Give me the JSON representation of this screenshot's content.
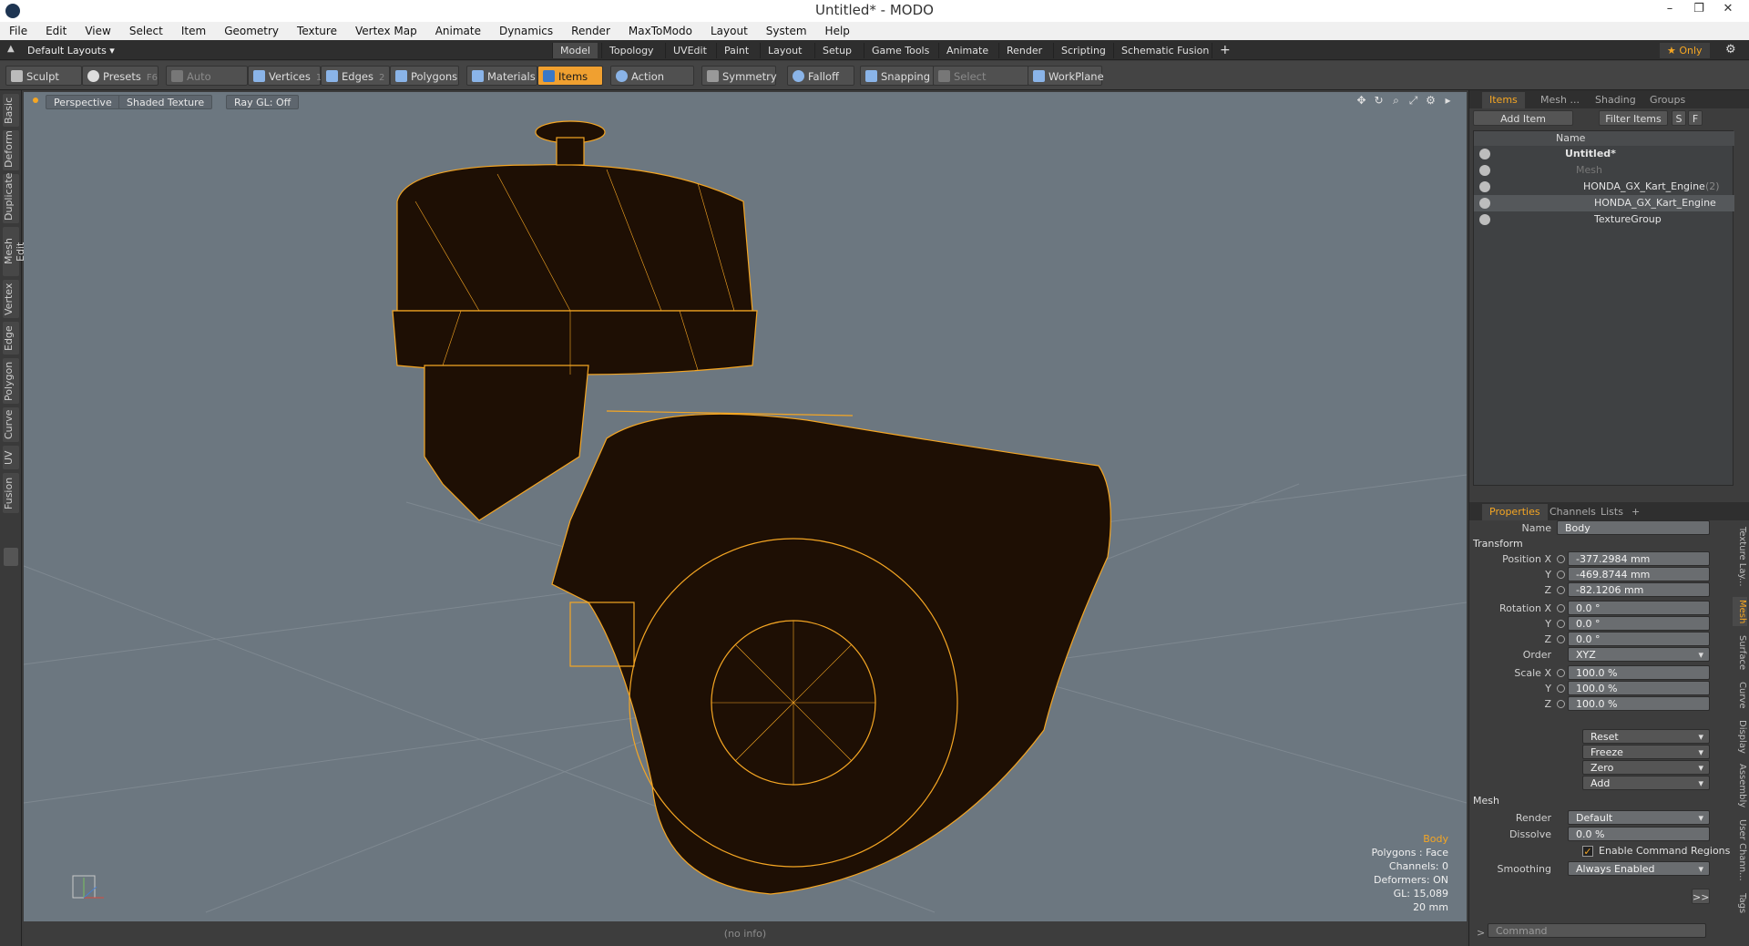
{
  "window": {
    "title": "Untitled* - MODO",
    "minimize": "–",
    "restore": "❐",
    "close": "✕"
  },
  "menu": [
    "File",
    "Edit",
    "View",
    "Select",
    "Item",
    "Geometry",
    "Texture",
    "Vertex Map",
    "Animate",
    "Dynamics",
    "Render",
    "MaxToModo",
    "Layout",
    "System",
    "Help"
  ],
  "layoutbar": {
    "preset": "Default Layouts ▾",
    "tabs": [
      "Model",
      "Topology",
      "UVEdit",
      "Paint",
      "Layout",
      "Setup",
      "Game Tools",
      "Animate",
      "Render",
      "Scripting",
      "Schematic Fusion",
      "+"
    ],
    "active_tab": "Model",
    "only": "★  Only"
  },
  "toolbar": {
    "sculpt": "Sculpt",
    "presets": "Presets",
    "presets_key": "F6",
    "auto_select": "Auto Select",
    "vertices": "Vertices",
    "vertices_num": "1",
    "edges": "Edges",
    "edges_num": "2",
    "polygons": "Polygons",
    "materials": "Materials",
    "items": "Items",
    "action_center": "Action Center",
    "symmetry": "Symmetry",
    "falloff": "Falloff",
    "snapping": "Snapping",
    "select_through": "Select Through",
    "workplane": "WorkPlane"
  },
  "left_tabs": [
    "Basic",
    "Deform",
    "Duplicate",
    "Mesh Edit",
    "Vertex",
    "Edge",
    "Polygon",
    "Curve",
    "UV",
    "Fusion"
  ],
  "viewport": {
    "view": "Perspective",
    "shading": "Shaded Texture",
    "raygl": "Ray GL: Off",
    "info": {
      "selected": "Body",
      "polygons": "Polygons : Face",
      "channels": "Channels: 0",
      "deformers": "Deformers: ON",
      "gl": "GL: 15,089",
      "scale": "20 mm"
    },
    "accent": "#f5a623"
  },
  "status": "(no info)",
  "items_panel": {
    "tabs": [
      "Items",
      "Mesh ...",
      "Shading",
      "Groups"
    ],
    "active": "Items",
    "add_item": "Add Item",
    "filter": "Filter Items",
    "s_btn": "S",
    "f_btn": "F",
    "col_name": "Name",
    "rows": [
      {
        "name": "Untitled*"
      },
      {
        "name": "Mesh"
      },
      {
        "name": "HONDA_GX_Kart_Engine",
        "count": "(2)"
      },
      {
        "name": "HONDA_GX_Kart_Engine"
      },
      {
        "name": "TextureGroup"
      }
    ]
  },
  "properties": {
    "tabs": [
      "Properties",
      "Channels",
      "Lists",
      "+"
    ],
    "active": "Properties",
    "name_label": "Name",
    "name_value": "Body",
    "transform": "Transform",
    "pos_x_label": "Position X",
    "pos_x": "-377.2984 mm",
    "pos_y_label": "Y",
    "pos_y": "-469.8744 mm",
    "pos_z_label": "Z",
    "pos_z": "-82.1206 mm",
    "rot_x_label": "Rotation X",
    "rot_x": "0.0 °",
    "rot_y_label": "Y",
    "rot_y": "0.0 °",
    "rot_z_label": "Z",
    "rot_z": "0.0 °",
    "order_label": "Order",
    "order": "XYZ",
    "scale_x_label": "Scale X",
    "scale_x": "100.0 %",
    "scale_y_label": "Y",
    "scale_y": "100.0 %",
    "scale_z_label": "Z",
    "scale_z": "100.0 %",
    "reset": "Reset",
    "freeze": "Freeze",
    "zero": "Zero",
    "add": "Add",
    "mesh": "Mesh",
    "render_label": "Render",
    "render": "Default",
    "dissolve_label": "Dissolve",
    "dissolve": "0.0 %",
    "enable_cmd": "Enable Command Regions",
    "smoothing_label": "Smoothing",
    "smoothing": "Always Enabled",
    "more": ">>"
  },
  "right_vtabs": [
    "Texture Lay...",
    "Mesh",
    "Surface",
    "Curve",
    "Display",
    "Assembly",
    "User Chann...",
    "Tags"
  ],
  "command": "Command"
}
